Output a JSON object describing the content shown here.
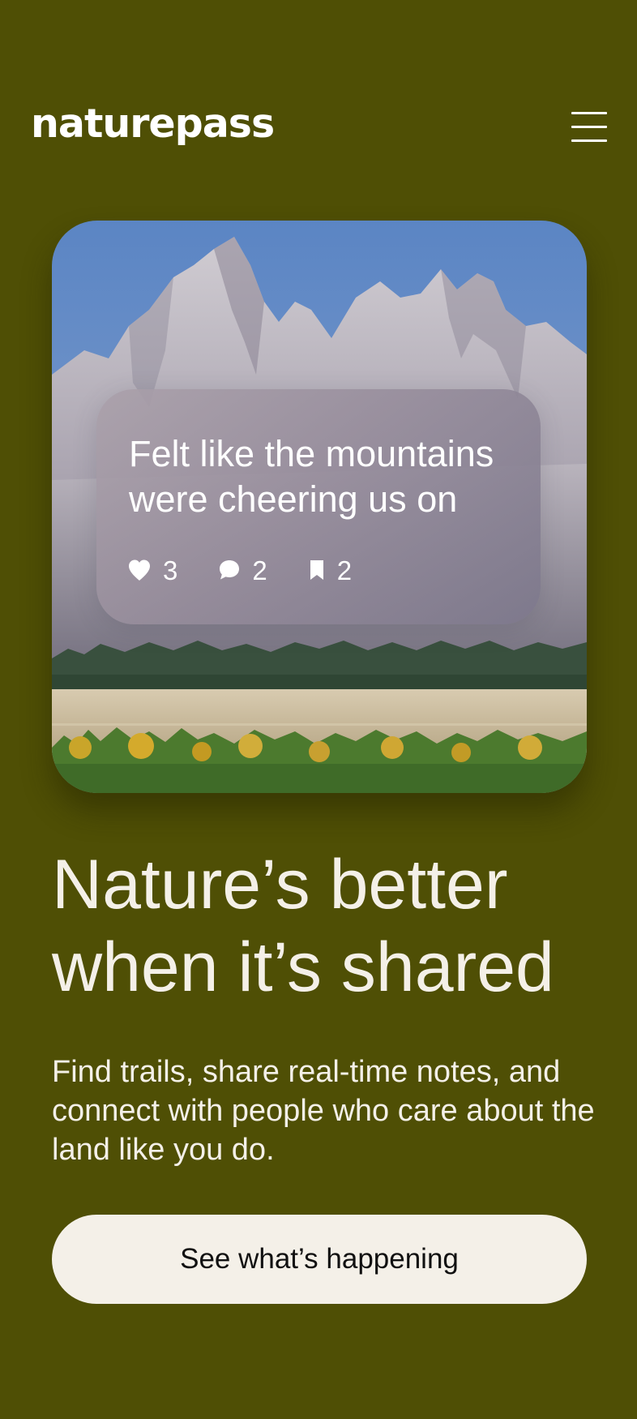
{
  "header": {
    "logo": "naturepass",
    "menu_icon": "hamburger-menu-icon"
  },
  "hero": {
    "image": "mountain-landscape",
    "post": {
      "text": "Felt like the mountains were cheering us on",
      "likes": "3",
      "comments": "2",
      "bookmarks": "2",
      "icons": [
        "heart-icon",
        "comment-icon",
        "bookmark-icon"
      ]
    }
  },
  "main": {
    "headline_line1": "Nature’s better",
    "headline_line2": "when it’s shared",
    "subtext": "Find trails, share real-time notes, and connect with people who care about the land like you do.",
    "cta_label": "See what’s happening"
  },
  "colors": {
    "background": "#4f4f05",
    "text": "#f4f0e8",
    "button": "#f4f0e8",
    "button_text": "#111111"
  }
}
